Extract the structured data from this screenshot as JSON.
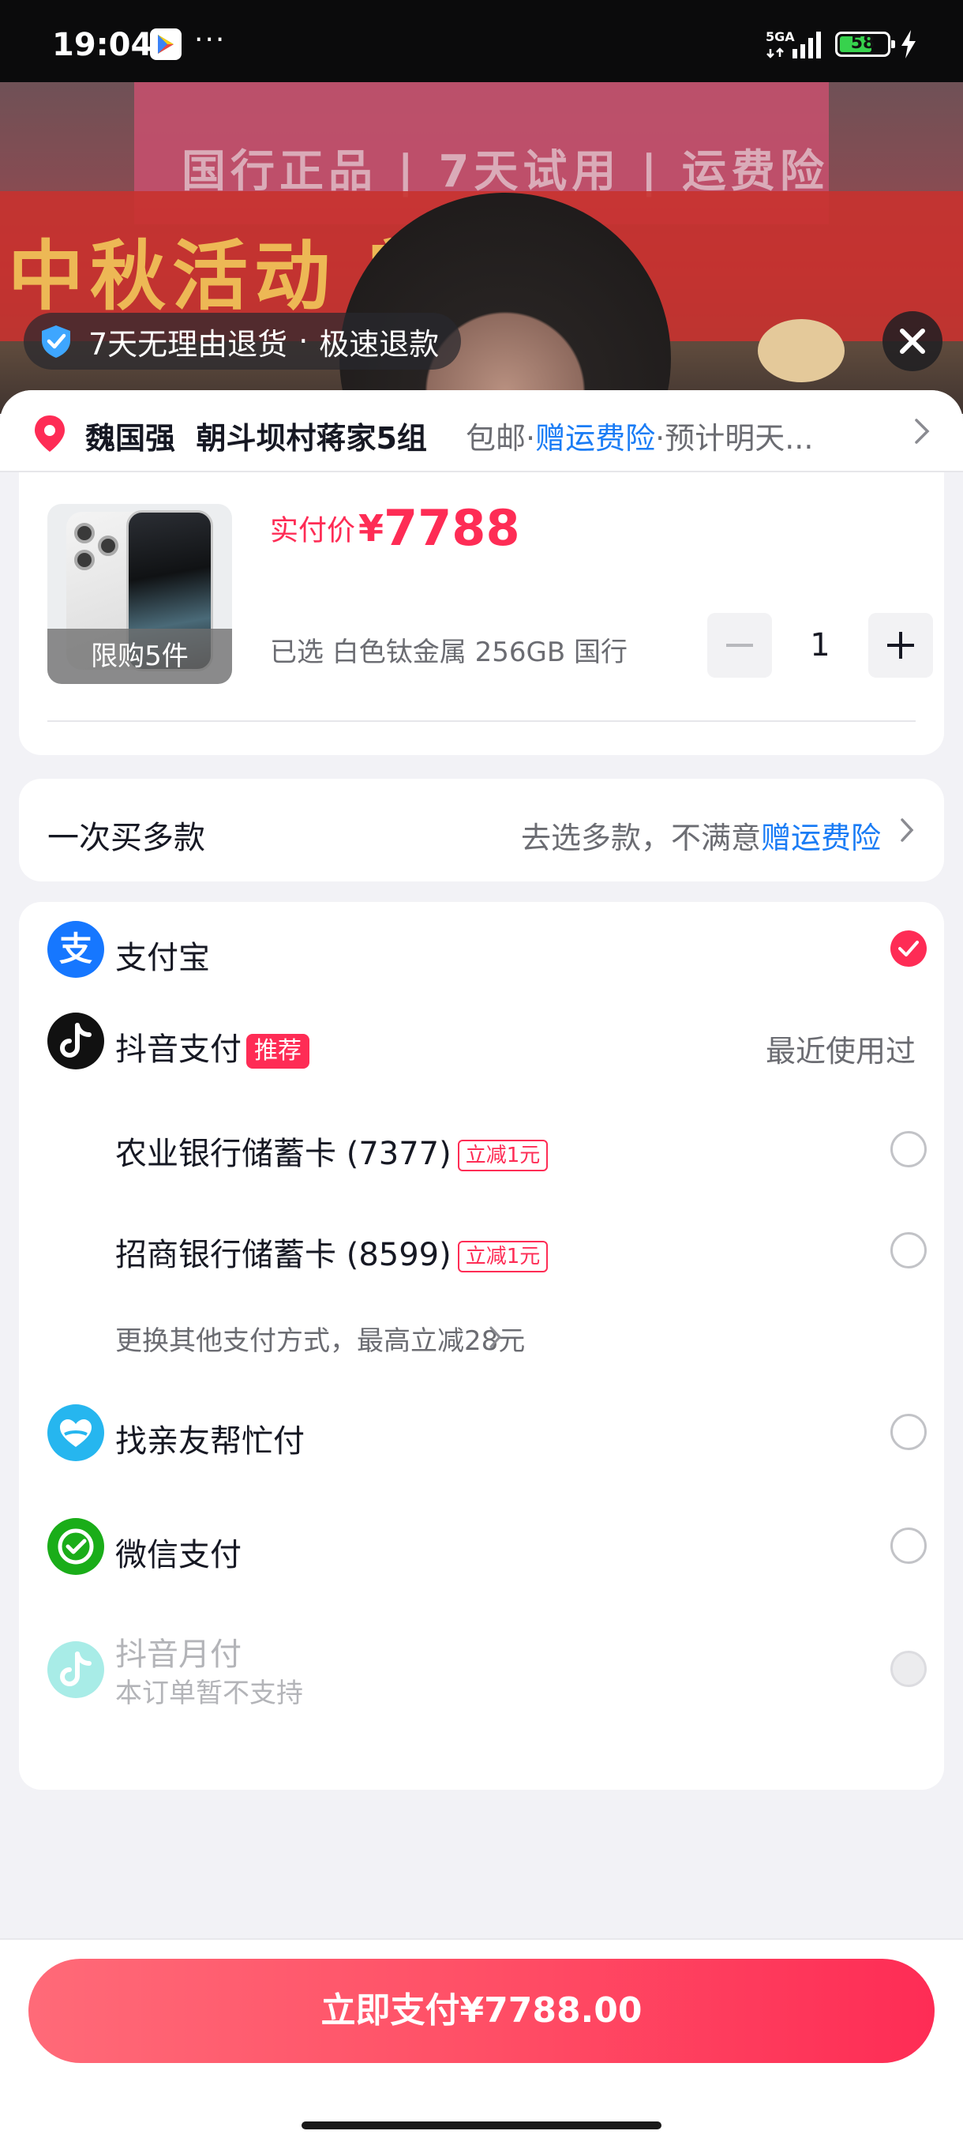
{
  "status_bar": {
    "time": "19:04",
    "dots": "···",
    "network": "5GA",
    "battery": "58"
  },
  "video": {
    "banner_top": "国行正品 | 7天试用 | 运费险",
    "banner_main": "中秋活动 额补贴",
    "refund_badge": {
      "text": "7天无理由退货",
      "separator": "·",
      "text2": "极速退款"
    }
  },
  "address": {
    "name": "魏国强",
    "location": "朝斗坝村蒋家5组",
    "shipping": "包邮",
    "sep1": "·",
    "insurance": "赠运费险",
    "sep2": "·",
    "eta": "预计明天..."
  },
  "product": {
    "limit_label": "限购5件",
    "price_label": "实付价",
    "currency": "¥",
    "price": "7788",
    "spec": "已选 白色钛金属 256GB 国行",
    "quantity": "1"
  },
  "multi_buy": {
    "title": "一次买多款",
    "hint": "去选多款，不满意",
    "insurance": "赠运费险"
  },
  "payment": {
    "methods": [
      {
        "label": "支付宝",
        "icon": "alipay-icon",
        "selected": true
      },
      {
        "label": "抖音支付",
        "icon": "douyin-pay-icon",
        "tag": "推荐",
        "right_text": "最近使用过"
      },
      {
        "label": "农业银行储蓄卡 (7377)",
        "tag": "立减1元"
      },
      {
        "label": "招商银行储蓄卡 (8599)",
        "tag": "立减1元"
      },
      {
        "label": "找亲友帮忙付",
        "icon": "friend-pay-icon"
      },
      {
        "label": "微信支付",
        "icon": "wechat-pay-icon"
      },
      {
        "label": "抖音月付",
        "icon": "douyin-monthly-icon",
        "sub": "本订单暂不支持",
        "disabled": true
      }
    ],
    "more_methods": "更换其他支付方式，最高立减28元"
  },
  "bottom": {
    "pay_button": "立即支付¥7788.00"
  },
  "colors": {
    "accent": "#fe2c55",
    "link": "#1a7cf5",
    "alipay": "#1677ff",
    "wechat": "#1aad19"
  }
}
